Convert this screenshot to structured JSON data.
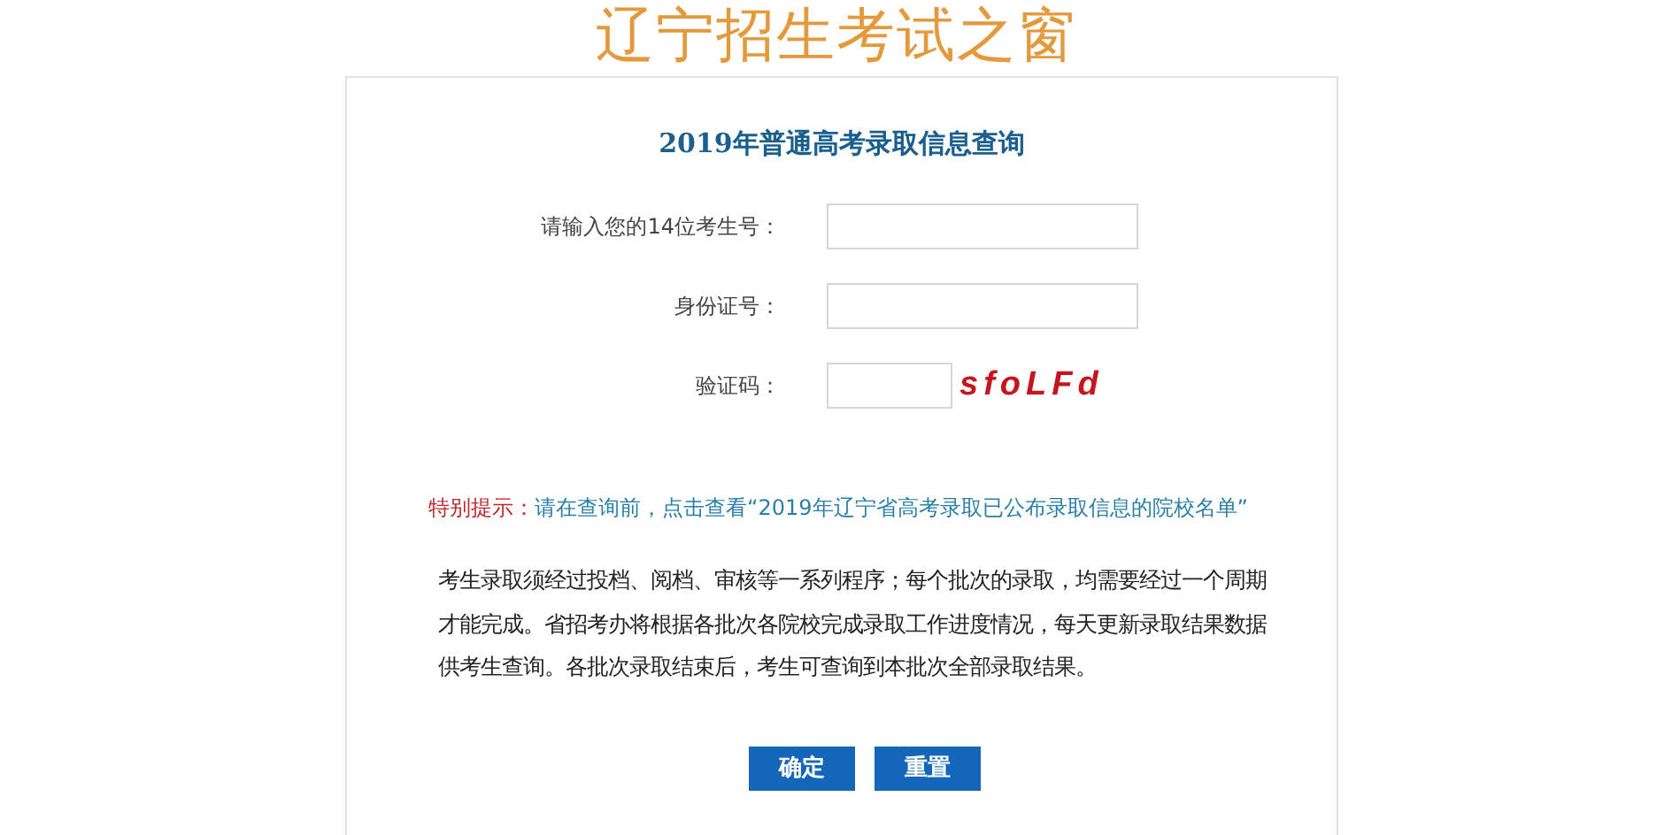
{
  "site_title": "辽宁招生考试之窗",
  "heading": "2019年普通高考录取信息查询",
  "fields": [
    {
      "label": "请输入您的14位考生号：",
      "kind": "text"
    },
    {
      "label": "身份证号：",
      "kind": "text"
    },
    {
      "label": "验证码：",
      "kind": "captcha",
      "captcha": "sfoLFd"
    }
  ],
  "notice": {
    "label": "特别提示：",
    "link": "请在查询前，点击查看“2019年辽宁省高考录取已公布录取信息的院校名单”"
  },
  "description": "考生录取须经过投档、阅档、审核等一系列程序；每个批次的录取，均需要经过一个周期才能完成。省招考办将根据各批次各院校完成录取工作进度情况，每天更新录取结果数据供考生查询。各批次录取结束后，考生可查询到本批次全部录取结果。",
  "buttons": [
    "确定",
    "重置"
  ]
}
